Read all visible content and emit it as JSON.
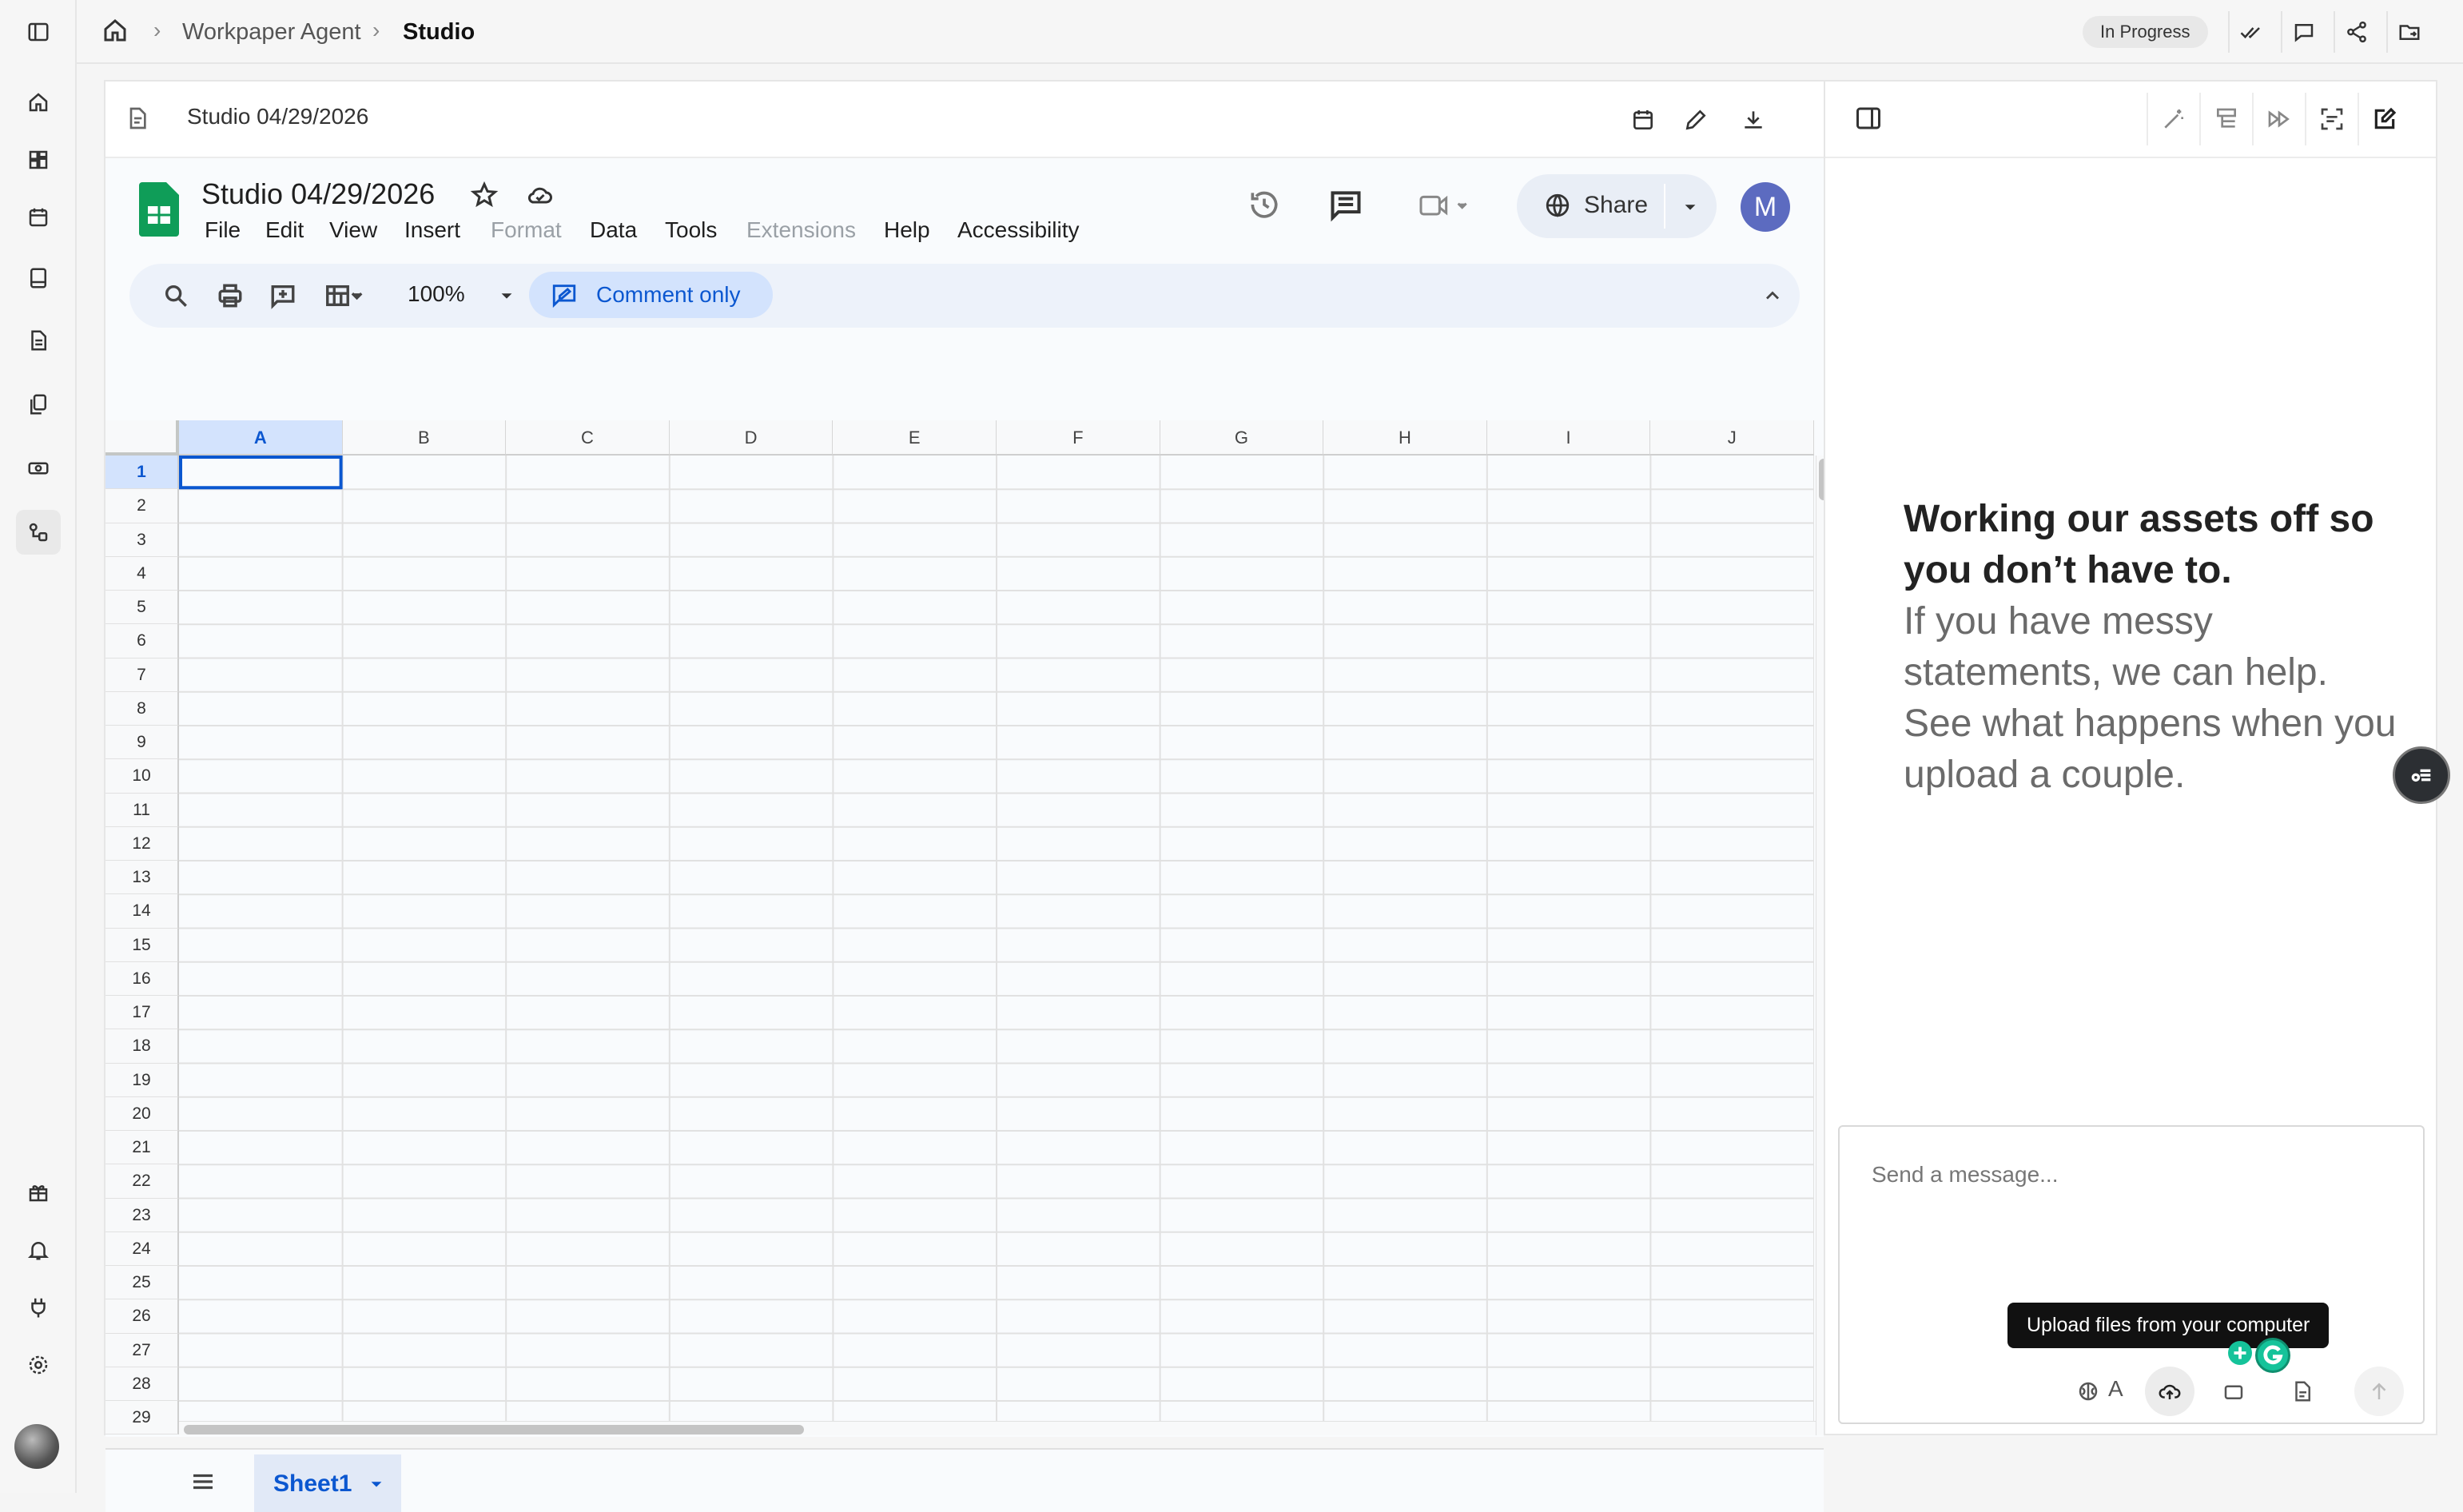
{
  "breadcrumb": {
    "items": [
      "Workpaper Agent",
      "Studio"
    ]
  },
  "status_badge": "In Progress",
  "document": {
    "title": "Studio 04/29/2026"
  },
  "sheets": {
    "title": "Studio 04/29/2026",
    "menu": [
      "File",
      "Edit",
      "View",
      "Insert",
      "Format",
      "Data",
      "Tools",
      "Extensions",
      "Help",
      "Accessibility"
    ],
    "disabled_menu": [
      "Format",
      "Extensions"
    ],
    "share_label": "Share",
    "avatar_letter": "M",
    "toolbar": {
      "zoom": "100%",
      "mode_label": "Comment only"
    },
    "columns": [
      "A",
      "B",
      "C",
      "D",
      "E",
      "F",
      "G",
      "H",
      "I",
      "J"
    ],
    "rows": [
      "1",
      "2",
      "3",
      "4",
      "5",
      "6",
      "7",
      "8",
      "9",
      "10",
      "11",
      "12",
      "13",
      "14",
      "15",
      "16",
      "17",
      "18",
      "19",
      "20",
      "21",
      "22",
      "23",
      "24",
      "25",
      "26",
      "27",
      "28",
      "29"
    ],
    "selected_cell": "A1",
    "sheet_tab": "Sheet1",
    "accent_color": "#0b57d0",
    "brand_color": "#0f9d58"
  },
  "chat": {
    "hero_bold": "Working our assets off so you don’t have to.",
    "hero_light": "If you have messy statements, we can help. See what happens when you upload a couple.",
    "input_placeholder": "Send a message...",
    "tooltip": "Upload files from your computer",
    "model_label": "A"
  }
}
